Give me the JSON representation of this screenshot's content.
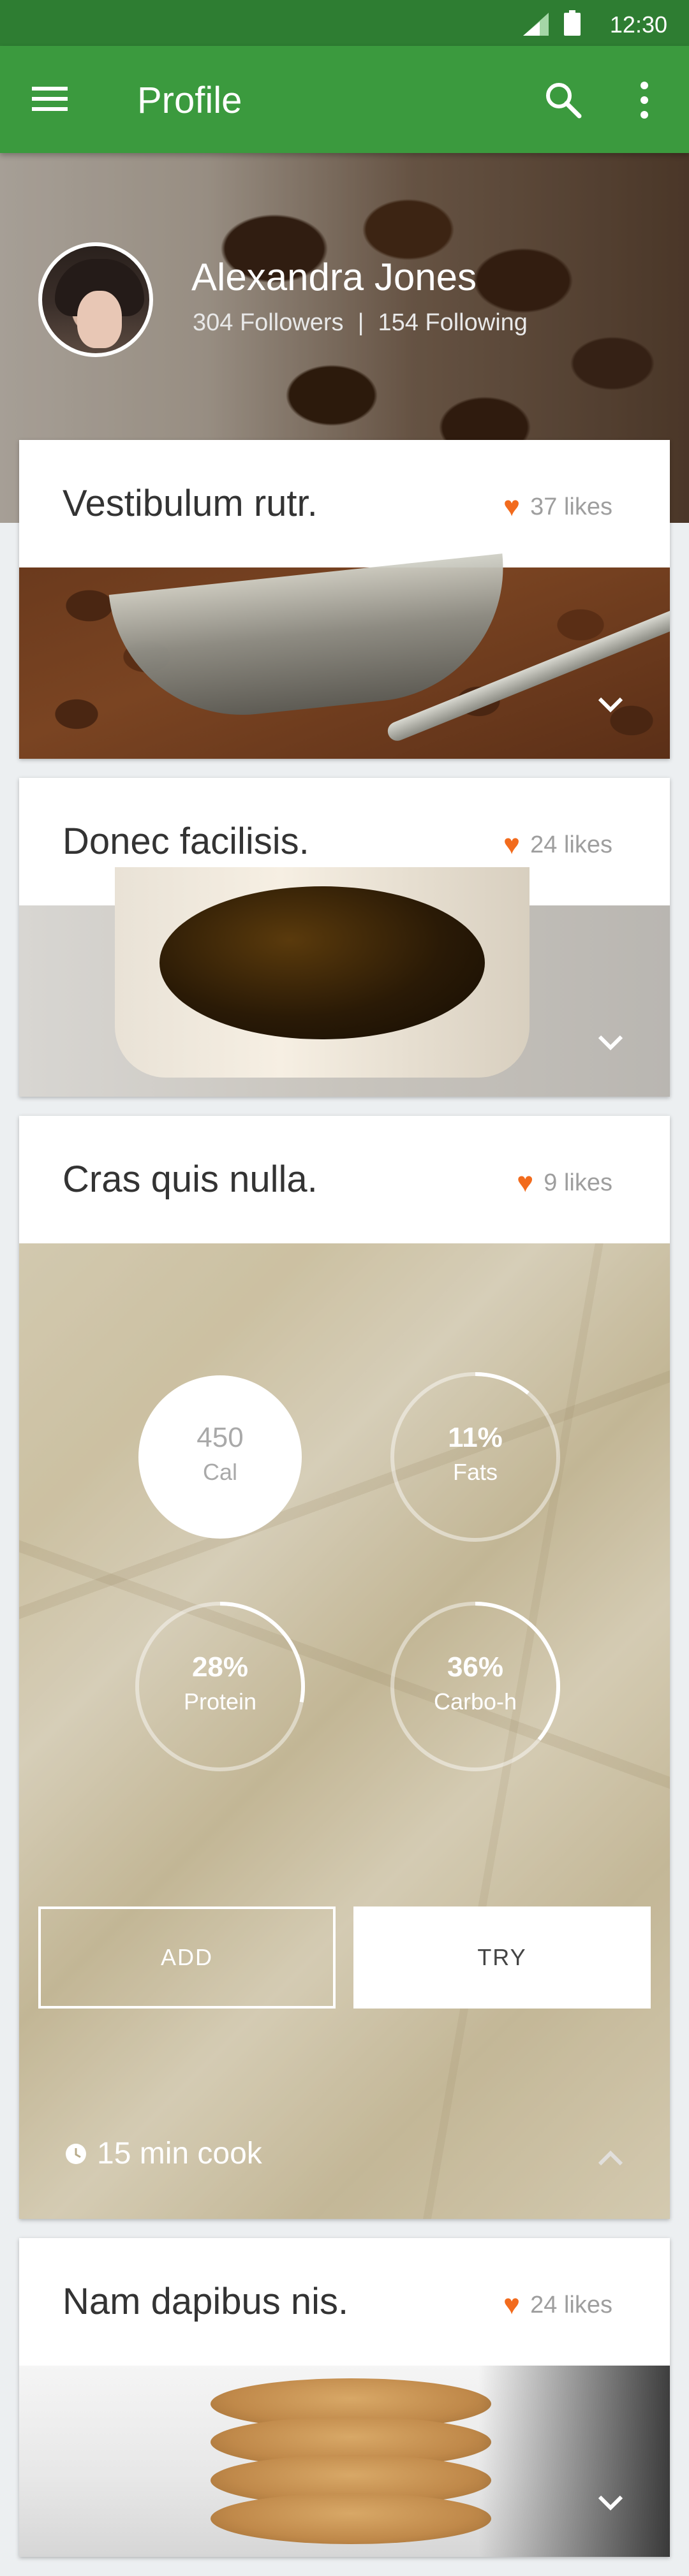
{
  "status_bar": {
    "time": "12:30"
  },
  "app_bar": {
    "title": "Profile"
  },
  "profile": {
    "name": "Alexandra Jones",
    "followers": "304 Followers",
    "separator": "|",
    "following": "154 Following"
  },
  "cards": [
    {
      "title": "Vestibulum rutr.",
      "likes": "37 likes",
      "image": "coffee-grinder-photo"
    },
    {
      "title": "Donec facilisis.",
      "likes": "24 likes",
      "image": "honey-cup-photo"
    },
    {
      "title": "Cras quis nulla.",
      "likes": "9 likes",
      "image": "cheese-photo",
      "nutrition": [
        {
          "value": "450",
          "label": "Cal",
          "fraction": 1.0
        },
        {
          "value": "11%",
          "label": "Fats",
          "fraction": 0.11
        },
        {
          "value": "28%",
          "label": "Protein",
          "fraction": 0.28
        },
        {
          "value": "36%",
          "label": "Carbo-h",
          "fraction": 0.36
        }
      ],
      "add_label": "ADD",
      "try_label": "TRY",
      "cook_time": "15 min cook"
    },
    {
      "title": "Nam dapibus nis.",
      "likes": "24 likes",
      "image": "cookies-photo"
    }
  ],
  "colors": {
    "status_bar": "#2e7d32",
    "app_bar": "#3b9a3e",
    "heart": "#f26b1d",
    "background": "#eceff1"
  }
}
